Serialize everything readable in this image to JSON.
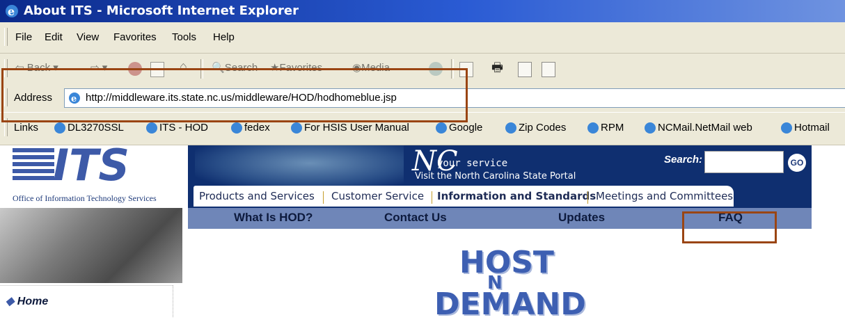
{
  "window": {
    "title": "About ITS - Microsoft Internet Explorer"
  },
  "menu": [
    "File",
    "Edit",
    "View",
    "Favorites",
    "Tools",
    "Help"
  ],
  "toolbar": {
    "back": "Back",
    "search": "Search",
    "favorites": "Favorites",
    "media": "Media"
  },
  "address": {
    "label": "Address",
    "url": "http://middleware.its.state.nc.us/middleware/HOD/hodhomeblue.jsp"
  },
  "links": {
    "label": "Links",
    "items": [
      "DL3270SSL",
      "ITS - HOD",
      "fedex",
      "For HSIS User Manual",
      "Google",
      "Zip Codes",
      "RPM",
      "NCMail.NetMail web",
      "Hotmail"
    ]
  },
  "site": {
    "logo": "ITS",
    "org": "Office of Information Technology Services",
    "portal_logo": "NC",
    "tagline1": "your service",
    "tagline2": "Visit the North Carolina State Portal",
    "search_label": "Search:",
    "search_value": "",
    "go": "GO",
    "tabs": [
      "Products and Services",
      "Customer Service",
      "Information and Standards",
      "Meetings and Committees"
    ],
    "subnav": [
      "What Is HOD?",
      "Contact Us",
      "Updates",
      "FAQ"
    ],
    "sidebar_home": "Home",
    "hod_logo": [
      "HOST",
      "N",
      "DEMAND"
    ]
  },
  "colors": {
    "highlight": "#9a4513",
    "banner": "#0f2f70",
    "subnav": "#6f86b8"
  }
}
